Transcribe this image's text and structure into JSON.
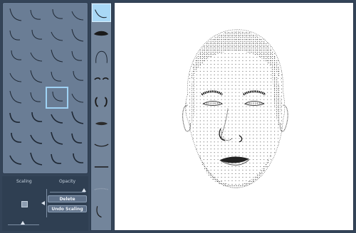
{
  "controls": {
    "scaling_label": "Scaling",
    "opacity_label": "Opacity",
    "delete_label": "Delete",
    "undo_scaling_label": "Undo Scaling"
  },
  "feature_grid": {
    "rows": 8,
    "columns": 4,
    "selected_row": 4,
    "selected_column": 2
  },
  "feature_strip": {
    "items": [
      "hairline",
      "hair",
      "head-outline",
      "eyebrows",
      "ears",
      "lips",
      "chin",
      "mouth",
      "facial-hair",
      "lower-face-outline"
    ],
    "selected_index": 1
  },
  "colors": {
    "panel": "#6a7d95",
    "background": "#344458",
    "selection": "#9fd2f4"
  }
}
